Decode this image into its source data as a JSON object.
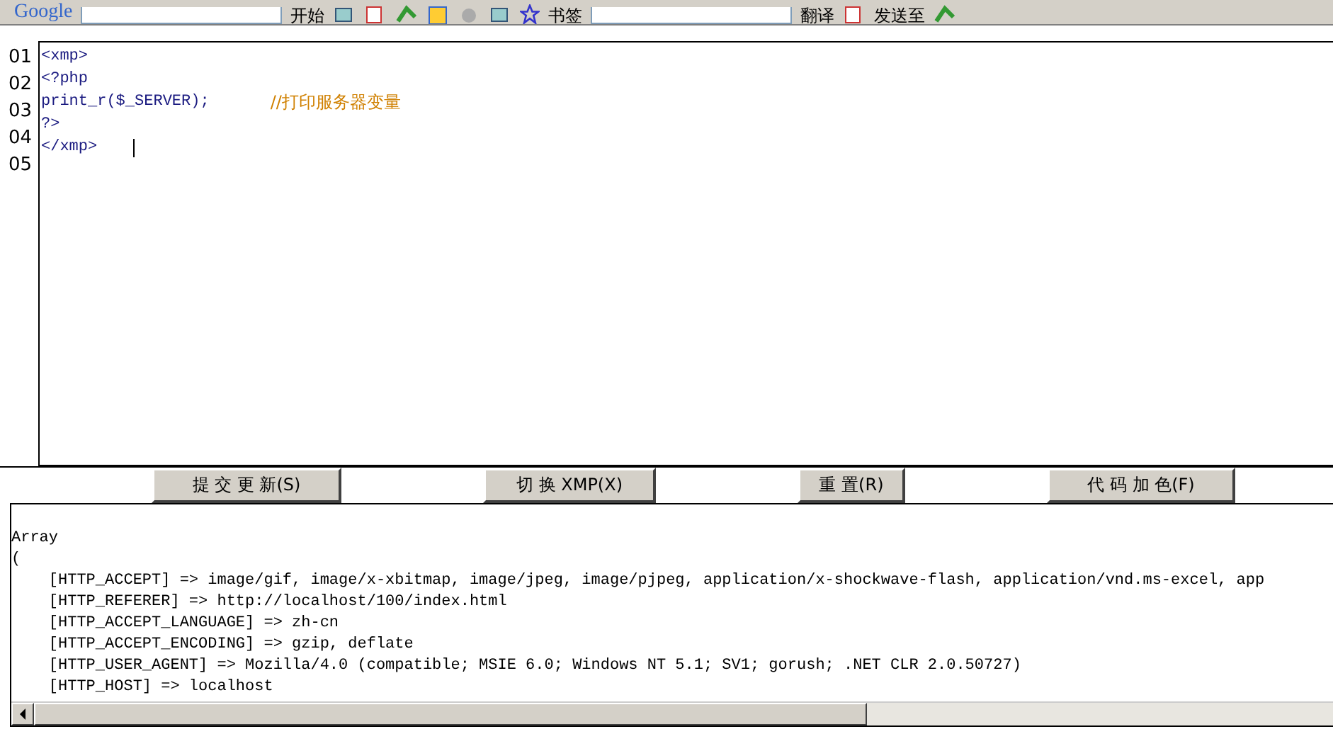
{
  "toolbar": {
    "items": [
      {
        "kind": "logo",
        "text": "Google"
      },
      {
        "kind": "field"
      },
      {
        "kind": "text",
        "text": "开始"
      },
      {
        "kind": "icon"
      },
      {
        "kind": "icon"
      },
      {
        "kind": "icon"
      },
      {
        "kind": "icon"
      },
      {
        "kind": "icon"
      },
      {
        "kind": "icon"
      },
      {
        "kind": "star",
        "text": "书签"
      },
      {
        "kind": "field"
      },
      {
        "kind": "text",
        "text": "翻译"
      },
      {
        "kind": "icon"
      },
      {
        "kind": "text",
        "text": "发送至"
      },
      {
        "kind": "icon"
      }
    ]
  },
  "editor": {
    "line_numbers": [
      "01",
      "02",
      "03",
      "04",
      "05"
    ],
    "lines": [
      {
        "code": "<xmp>"
      },
      {
        "code": "<?php"
      },
      {
        "code": "print_r($_SERVER);",
        "comment": "//打印服务器变量"
      },
      {
        "code": "?>"
      },
      {
        "code": "</xmp>"
      }
    ]
  },
  "buttons": [
    "提 交 更 新(S)",
    "切 换 XMP(X)",
    "重 置(R)",
    "代 码 加 色(F)"
  ],
  "output": {
    "lines": [
      "Array",
      "(",
      "    [HTTP_ACCEPT] => image/gif, image/x-xbitmap, image/jpeg, image/pjpeg, application/x-shockwave-flash, application/vnd.ms-excel, app",
      "    [HTTP_REFERER] => http://localhost/100/index.html",
      "    [HTTP_ACCEPT_LANGUAGE] => zh-cn",
      "    [HTTP_ACCEPT_ENCODING] => gzip, deflate",
      "    [HTTP_USER_AGENT] => Mozilla/4.0 (compatible; MSIE 6.0; Windows NT 5.1; SV1; gorush; .NET CLR 2.0.50727)",
      "    [HTTP_HOST] => localhost"
    ]
  }
}
